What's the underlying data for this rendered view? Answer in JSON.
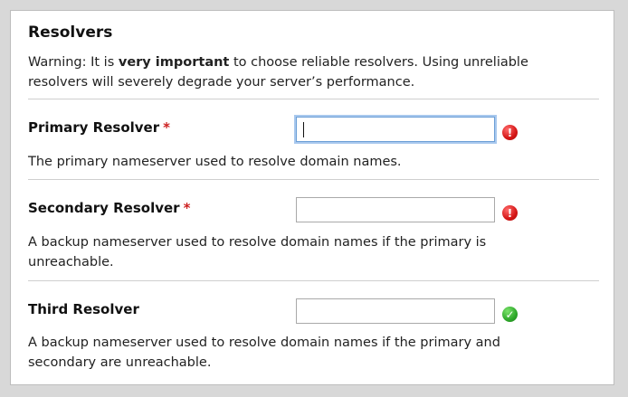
{
  "section": {
    "title": "Resolvers",
    "warning_prefix": "Warning: It is ",
    "warning_bold": "very important",
    "warning_suffix": " to choose reliable resolvers. Using unreliable resolvers will severely degrade your server’s performance."
  },
  "fields": [
    {
      "label": "Primary Resolver",
      "required_mark": "*",
      "value": "",
      "status": "error",
      "status_glyph": "!",
      "help": "The primary nameserver used to resolve domain names."
    },
    {
      "label": "Secondary Resolver",
      "required_mark": "*",
      "value": "",
      "status": "error",
      "status_glyph": "!",
      "help": "A backup nameserver used to resolve domain names if the primary is unreachable."
    },
    {
      "label": "Third Resolver",
      "required_mark": "",
      "value": "",
      "status": "ok",
      "status_glyph": "✓",
      "help": "A backup nameserver used to resolve domain names if the primary and secondary are unreachable."
    }
  ],
  "colors": {
    "required": "#cc1f1f",
    "error": "#d41515",
    "ok": "#2ea82a",
    "focus": "#6c9fd6"
  }
}
